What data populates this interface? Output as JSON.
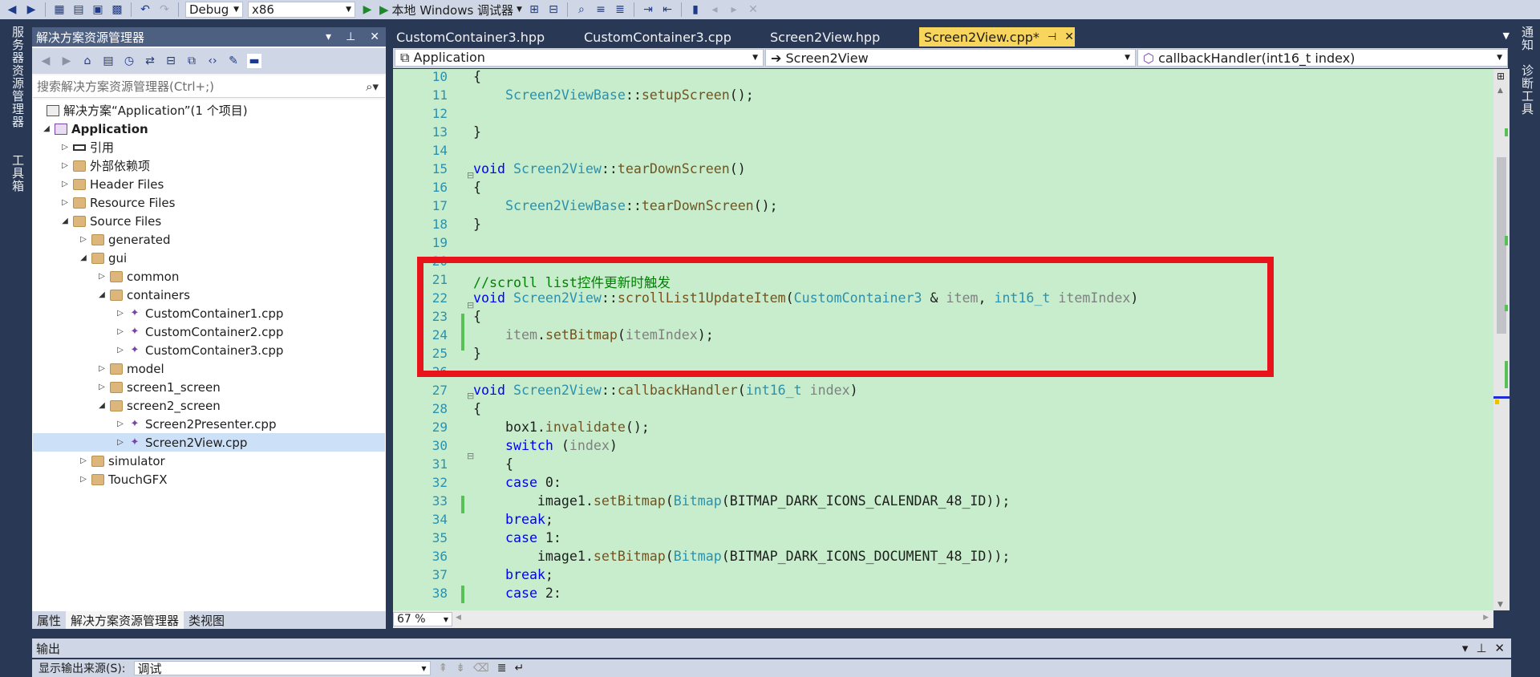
{
  "toolbar": {
    "config": "Debug",
    "platform": "x86",
    "debugger": "本地 Windows 调试器"
  },
  "left_strip": {
    "server_explorer": "服务器资源管理器",
    "toolbox": "工具箱"
  },
  "right_strip": {
    "notifications": "通知",
    "diagnostics": "诊断工具"
  },
  "solution_explorer": {
    "title": "解决方案资源管理器",
    "search_placeholder": "搜索解决方案资源管理器(Ctrl+;)",
    "tree": [
      "解决方案“Application”(1 个项目)",
      "Application",
      "引用",
      "外部依赖项",
      "Header Files",
      "Resource Files",
      "Source Files",
      "generated",
      "gui",
      "common",
      "containers",
      "CustomContainer1.cpp",
      "CustomContainer2.cpp",
      "CustomContainer3.cpp",
      "model",
      "screen1_screen",
      "screen2_screen",
      "Screen2Presenter.cpp",
      "Screen2View.cpp",
      "simulator",
      "TouchGFX"
    ],
    "bottom_tabs": [
      "属性",
      "解决方案资源管理器",
      "类视图"
    ]
  },
  "editor": {
    "tabs": [
      "CustomContainer3.hpp",
      "CustomContainer3.cpp",
      "Screen2View.hpp",
      "Screen2View.cpp*"
    ],
    "nav": {
      "project": "Application",
      "class": "Screen2View",
      "member": "callbackHandler(int16_t index)"
    },
    "zoom": "67 %",
    "line_numbers": [
      "10",
      "11",
      "12",
      "13",
      "14",
      "15",
      "16",
      "17",
      "18",
      "19",
      "20",
      "21",
      "22",
      "23",
      "24",
      "25",
      "26",
      "27",
      "28",
      "29",
      "30",
      "31",
      "32",
      "33",
      "34",
      "35",
      "36",
      "37",
      "38"
    ]
  },
  "output": {
    "title": "输出",
    "source_label": "显示输出来源(S):",
    "source_value": "调试"
  },
  "colors": {
    "editor_bg": "#c7edcc",
    "highlight_border": "#e8141c",
    "active_tab": "#f8d55c",
    "keyword": "#0000ff",
    "type": "#2b91af"
  }
}
